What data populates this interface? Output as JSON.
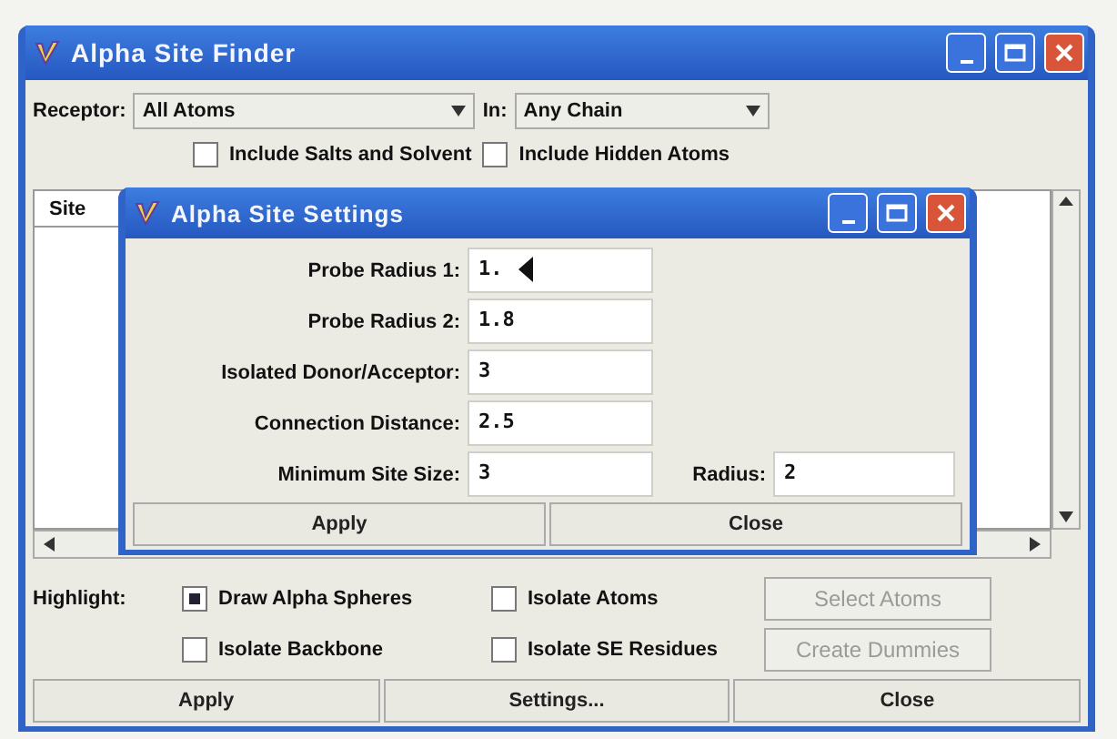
{
  "window": {
    "title": "Alpha Site Finder"
  },
  "receptor": {
    "label": "Receptor:",
    "value": "All Atoms"
  },
  "chain": {
    "label": "In:",
    "value": "Any Chain"
  },
  "include_options": [
    {
      "label": "Include Salts and Solvent",
      "checked": false
    },
    {
      "label": "Include Hidden Atoms",
      "checked": false
    }
  ],
  "table": {
    "columns": [
      "Site"
    ]
  },
  "settings_dialog": {
    "title": "Alpha Site Settings",
    "fields": [
      {
        "label": "Probe Radius 1:",
        "value": "1."
      },
      {
        "label": "Probe Radius 2:",
        "value": "1.8"
      },
      {
        "label": "Isolated Donor/Acceptor:",
        "value": "3"
      },
      {
        "label": "Connection Distance:",
        "value": "2.5"
      },
      {
        "label": "Minimum Site Size:",
        "value": "3"
      }
    ],
    "radius": {
      "label": "Radius:",
      "value": "2"
    },
    "buttons": [
      "Apply",
      "Close"
    ]
  },
  "highlight": {
    "label": "Highlight:",
    "options": [
      {
        "label": "Draw Alpha Spheres",
        "checked": true
      },
      {
        "label": "Isolate Atoms",
        "checked": false
      },
      {
        "label": "Isolate Backbone",
        "checked": false
      },
      {
        "label": "Isolate SE Residues",
        "checked": false
      }
    ]
  },
  "actions": [
    {
      "label": "Select Atoms",
      "disabled": true
    },
    {
      "label": "Create Dummies",
      "disabled": true
    }
  ],
  "buttons": [
    "Apply",
    "Settings...",
    "Close"
  ]
}
